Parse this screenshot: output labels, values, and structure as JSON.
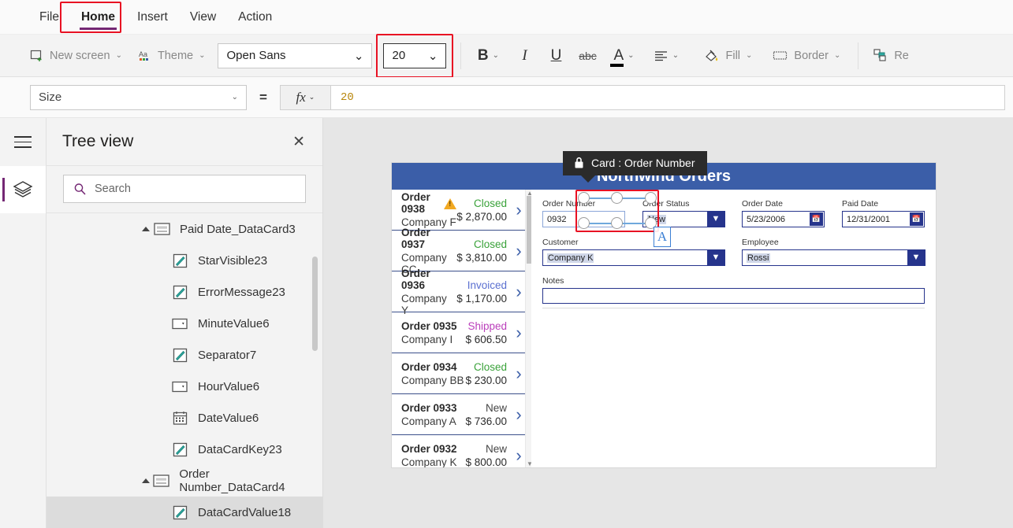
{
  "menu": {
    "items": [
      {
        "label": "File",
        "active": false
      },
      {
        "label": "Home",
        "active": true
      },
      {
        "label": "Insert",
        "active": false
      },
      {
        "label": "View",
        "active": false
      },
      {
        "label": "Action",
        "active": false
      }
    ]
  },
  "ribbon": {
    "new_screen": "New screen",
    "theme": "Theme",
    "font_family": "Open Sans",
    "font_size": "20",
    "bold": "B",
    "italic": "I",
    "underline": "U",
    "strikethrough": "abc",
    "font_color": "A",
    "align": "align-left",
    "fill": "Fill",
    "border": "Border",
    "reorder": "Re",
    "chevron": "⌄",
    "accent_highlight": "#e81123"
  },
  "formula_bar": {
    "property": "Size",
    "equals": "=",
    "fx": "fx",
    "value": "20"
  },
  "tree_view": {
    "title": "Tree view",
    "close": "✕",
    "search_placeholder": "Search",
    "search_value": "",
    "nodes": [
      {
        "label": "Paid Date_DataCard3",
        "icon": "datacard-icon",
        "depth": 1,
        "expanded": true,
        "selected": false
      },
      {
        "label": "StarVisible23",
        "icon": "label-edit-icon",
        "depth": 2,
        "expanded": false,
        "selected": false
      },
      {
        "label": "ErrorMessage23",
        "icon": "label-edit-icon",
        "depth": 2,
        "expanded": false,
        "selected": false
      },
      {
        "label": "MinuteValue6",
        "icon": "dropdown-icon",
        "depth": 2,
        "expanded": false,
        "selected": false
      },
      {
        "label": "Separator7",
        "icon": "label-edit-icon",
        "depth": 2,
        "expanded": false,
        "selected": false
      },
      {
        "label": "HourValue6",
        "icon": "dropdown-icon",
        "depth": 2,
        "expanded": false,
        "selected": false
      },
      {
        "label": "DateValue6",
        "icon": "calendar-icon",
        "depth": 2,
        "expanded": false,
        "selected": false
      },
      {
        "label": "DataCardKey23",
        "icon": "label-edit-icon",
        "depth": 2,
        "expanded": false,
        "selected": false
      },
      {
        "label": "Order Number_DataCard4",
        "icon": "datacard-icon",
        "depth": 1,
        "expanded": true,
        "selected": false
      },
      {
        "label": "DataCardValue18",
        "icon": "label-edit-icon",
        "depth": 2,
        "expanded": false,
        "selected": true
      }
    ]
  },
  "rail": {
    "menu_icon": "hamburger-icon",
    "tree_icon": "layers-icon"
  },
  "app_preview": {
    "title": "Northwind Orders",
    "header_color": "#3b5ea8",
    "gallery": [
      {
        "order": "Order 0938",
        "company": "Company F",
        "status": "Closed",
        "status_color": "#3aa23a",
        "amount": "$ 2,870.00",
        "warning": true
      },
      {
        "order": "Order 0937",
        "company": "Company CC",
        "status": "Closed",
        "status_color": "#3aa23a",
        "amount": "$ 3,810.00",
        "warning": false
      },
      {
        "order": "Order 0936",
        "company": "Company Y",
        "status": "Invoiced",
        "status_color": "#5a6fd0",
        "amount": "$ 1,170.00",
        "warning": false
      },
      {
        "order": "Order 0935",
        "company": "Company I",
        "status": "Shipped",
        "status_color": "#bb3fbb",
        "amount": "$ 606.50",
        "warning": false
      },
      {
        "order": "Order 0934",
        "company": "Company BB",
        "status": "Closed",
        "status_color": "#3aa23a",
        "amount": "$ 230.00",
        "warning": false
      },
      {
        "order": "Order 0933",
        "company": "Company A",
        "status": "New",
        "status_color": "#444444",
        "amount": "$ 736.00",
        "warning": false
      },
      {
        "order": "Order 0932",
        "company": "Company K",
        "status": "New",
        "status_color": "#444444",
        "amount": "$ 800.00",
        "warning": false
      }
    ],
    "form": {
      "order_number": {
        "label": "Order Number",
        "value": "0932"
      },
      "order_status": {
        "label": "Order Status",
        "value": "New"
      },
      "order_date": {
        "label": "Order Date",
        "value": "5/23/2006"
      },
      "paid_date": {
        "label": "Paid Date",
        "value": "12/31/2001"
      },
      "customer": {
        "label": "Customer",
        "value": "Company K"
      },
      "employee": {
        "label": "Employee",
        "value": "Rossi"
      },
      "notes": {
        "label": "Notes",
        "value": ""
      }
    }
  },
  "tooltip": {
    "text": "Card : Order Number",
    "lock_icon": "lock-icon"
  },
  "resize_marker": {
    "label": "A"
  }
}
